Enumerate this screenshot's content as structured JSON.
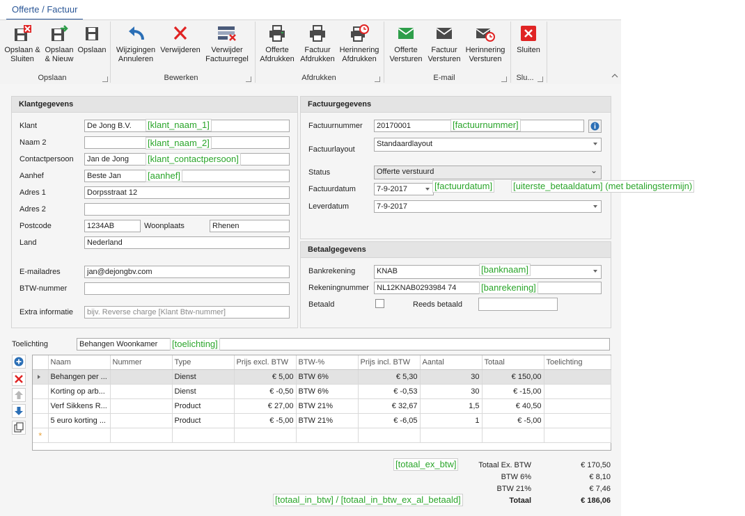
{
  "tab": {
    "label": "Offerte / Factuur"
  },
  "ribbon": {
    "buttons": {
      "save_close": "Opslaan & Sluiten",
      "save_new": "Opslaan & Nieuw",
      "save": "Opslaan",
      "undo": "Wijzigingen Annuleren",
      "delete": "Verwijderen",
      "delete_line": "Verwijder Factuurregel",
      "print_quote": "Offerte Afdrukken",
      "print_invoice": "Factuur Afdrukken",
      "print_reminder": "Herinnering Afdrukken",
      "send_quote": "Offerte Versturen",
      "send_invoice": "Factuur Versturen",
      "send_reminder": "Herinnering Versturen",
      "close": "Sluiten"
    },
    "groups": {
      "save": "Opslaan",
      "edit": "Bewerken",
      "print": "Afdrukken",
      "email": "E-mail",
      "close": "Slu..."
    }
  },
  "customer": {
    "title": "Klantgegevens",
    "labels": {
      "klant": "Klant",
      "naam2": "Naam 2",
      "contact": "Contactpersoon",
      "aanhef": "Aanhef",
      "adres1": "Adres 1",
      "adres2": "Adres 2",
      "postcode": "Postcode",
      "woonplaats": "Woonplaats",
      "land": "Land",
      "email": "E-mailadres",
      "btw": "BTW-nummer",
      "extra": "Extra informatie"
    },
    "values": {
      "klant": "De Jong B.V.",
      "naam2": "",
      "contact": "Jan de Jong",
      "aanhef": "Beste Jan",
      "adres1": "Dorpsstraat 12",
      "adres2": "",
      "postcode": "1234AB",
      "woonplaats": "Rhenen",
      "land": "Nederland",
      "email": "jan@dejongbv.com",
      "btw": "",
      "extra_placeholder": "bijv.  Reverse charge [Klant Btw-nummer]"
    }
  },
  "invoice": {
    "title": "Factuurgegevens",
    "labels": {
      "nummer": "Factuurnummer",
      "layout": "Factuurlayout",
      "status": "Status",
      "datum": "Factuurdatum",
      "lever": "Leverdatum"
    },
    "values": {
      "nummer": "20170001",
      "layout": "Standaardlayout",
      "status": "Offerte verstuurd",
      "datum": "7-9-2017",
      "lever": "7-9-2017"
    }
  },
  "payment": {
    "title": "Betaalgegevens",
    "labels": {
      "bank": "Bankrekening",
      "rekening": "Rekeningnummer",
      "betaald": "Betaald",
      "reeds": "Reeds betaald"
    },
    "values": {
      "bank": "KNAB",
      "rekening": "NL12KNAB0293984 74",
      "reeds": ""
    }
  },
  "toelichting": {
    "label": "Toelichting",
    "value": "Behangen Woonkamer"
  },
  "annotations": {
    "klant_naam_1": "[klant_naam_1]",
    "klant_naam_2": "[klant_naam_2]",
    "klant_contactpersoon": "[klant_contactpersoon]",
    "aanhef": "[aanhef]",
    "factuurnummer": "[factuurnummer]",
    "factuurdatum": "[factuurdatum]",
    "uiterste": "[uiterste_betaaldatum] (met betalingstermijn)",
    "banknaam": "[banknaam]",
    "banrekening": "[banrekening]",
    "toelichting": "[toelichting]",
    "totaal_ex": "[totaal_ex_btw]",
    "totaal_in": "[totaal_in_btw] / [totaal_in_btw_ex_al_betaald]"
  },
  "grid": {
    "columns": [
      "Naam",
      "Nummer",
      "Type",
      "Prijs excl. BTW",
      "BTW-%",
      "Prijs incl. BTW",
      "Aantal",
      "Totaal",
      "Toelichting"
    ],
    "rows": [
      [
        "Behangen per ...",
        "",
        "Dienst",
        "€ 5,00",
        "BTW 6%",
        "€ 5,30",
        "30",
        "€ 150,00",
        ""
      ],
      [
        "Korting op arb...",
        "",
        "Dienst",
        "€ -0,50",
        "BTW 6%",
        "€ -0,53",
        "30",
        "€ -15,00",
        ""
      ],
      [
        "Verf Sikkens R...",
        "",
        "Product",
        "€ 27,00",
        "BTW 21%",
        "€ 32,67",
        "1,5",
        "€ 40,50",
        ""
      ],
      [
        "5 euro korting ...",
        "",
        "Product",
        "€ -5,00",
        "BTW 21%",
        "€ -6,05",
        "1",
        "€ -5,00",
        ""
      ]
    ]
  },
  "totals": [
    {
      "label": "Totaal Ex. BTW",
      "value": "€ 170,50",
      "bold": false
    },
    {
      "label": "BTW 6%",
      "value": "€ 8,10",
      "bold": false
    },
    {
      "label": "BTW 21%",
      "value": "€ 7,46",
      "bold": false
    },
    {
      "label": "Totaal",
      "value": "€ 186,06",
      "bold": true
    }
  ],
  "colors": {
    "accent": "#2b5797",
    "annotation": "#2aa52a",
    "delete": "#e02424",
    "mail": "#2e9e4a"
  }
}
